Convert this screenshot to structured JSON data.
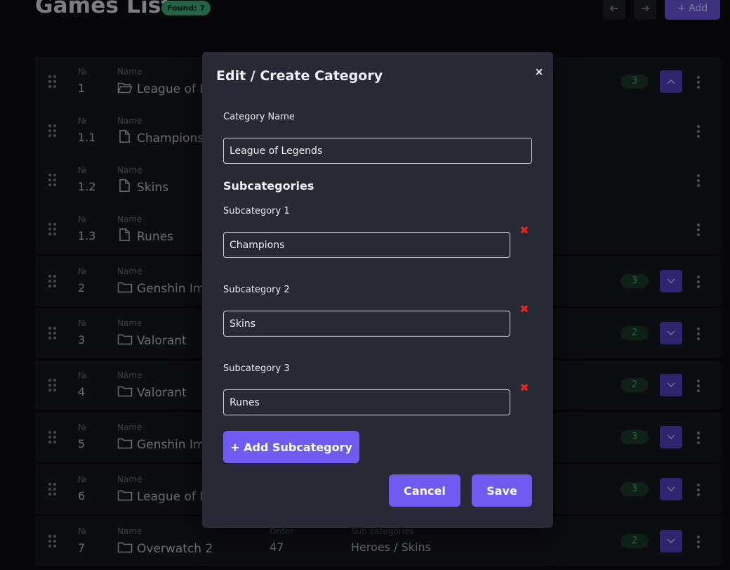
{
  "page": {
    "title": "Games List",
    "found_badge": "Found: 7",
    "prev_icon": "arrow-left-icon",
    "next_icon": "arrow-right-icon",
    "add_label": "+ Add"
  },
  "columns": {
    "num": "№",
    "name": "Name",
    "order": "Order",
    "subcategories": "Sub categories"
  },
  "rows": [
    {
      "num": "1",
      "name": "League of Le",
      "icon": "folder-open-icon",
      "count": "3",
      "expand": "up"
    },
    {
      "num": "1.1",
      "name": "Champions",
      "icon": "file-icon"
    },
    {
      "num": "1.2",
      "name": "Skins",
      "icon": "file-icon"
    },
    {
      "num": "1.3",
      "name": "Runes",
      "icon": "file-icon"
    },
    {
      "num": "2",
      "name": "Genshin Imp",
      "icon": "folder-icon",
      "count": "3",
      "expand": "down"
    },
    {
      "num": "3",
      "name": "Valorant",
      "icon": "folder-icon",
      "count": "2",
      "expand": "down"
    },
    {
      "num": "4",
      "name": "Valorant",
      "icon": "folder-icon",
      "count": "2",
      "expand": "down"
    },
    {
      "num": "5",
      "name": "Genshin Imp",
      "icon": "folder-icon",
      "count": "3",
      "expand": "down"
    },
    {
      "num": "6",
      "name": "League of Le",
      "icon": "folder-icon",
      "count": "3",
      "expand": "down"
    },
    {
      "num": "7",
      "name": "Overwatch 2",
      "icon": "folder-icon",
      "order": "47",
      "subcategories": "Heroes / Skins",
      "count": "2",
      "expand": "down"
    }
  ],
  "modal": {
    "title": "Edit / Create Category",
    "close_label": "×",
    "category_name_label": "Category Name",
    "category_name_value": "League of Legends",
    "subcategories_title": "Subcategories",
    "subcategories": [
      {
        "label": "Subcategory 1",
        "value": "Champions"
      },
      {
        "label": "Subcategory 2",
        "value": "Skins"
      },
      {
        "label": "Subcategory 3",
        "value": "Runes"
      }
    ],
    "remove_label": "✖",
    "add_subcategory_label": "+ Add Subcategory",
    "cancel_label": "Cancel",
    "save_label": "Save"
  },
  "colors": {
    "accent": "#6d5cf0",
    "found": "#3fb27f",
    "remove": "#e8231f",
    "modal_bg": "#262a35"
  }
}
